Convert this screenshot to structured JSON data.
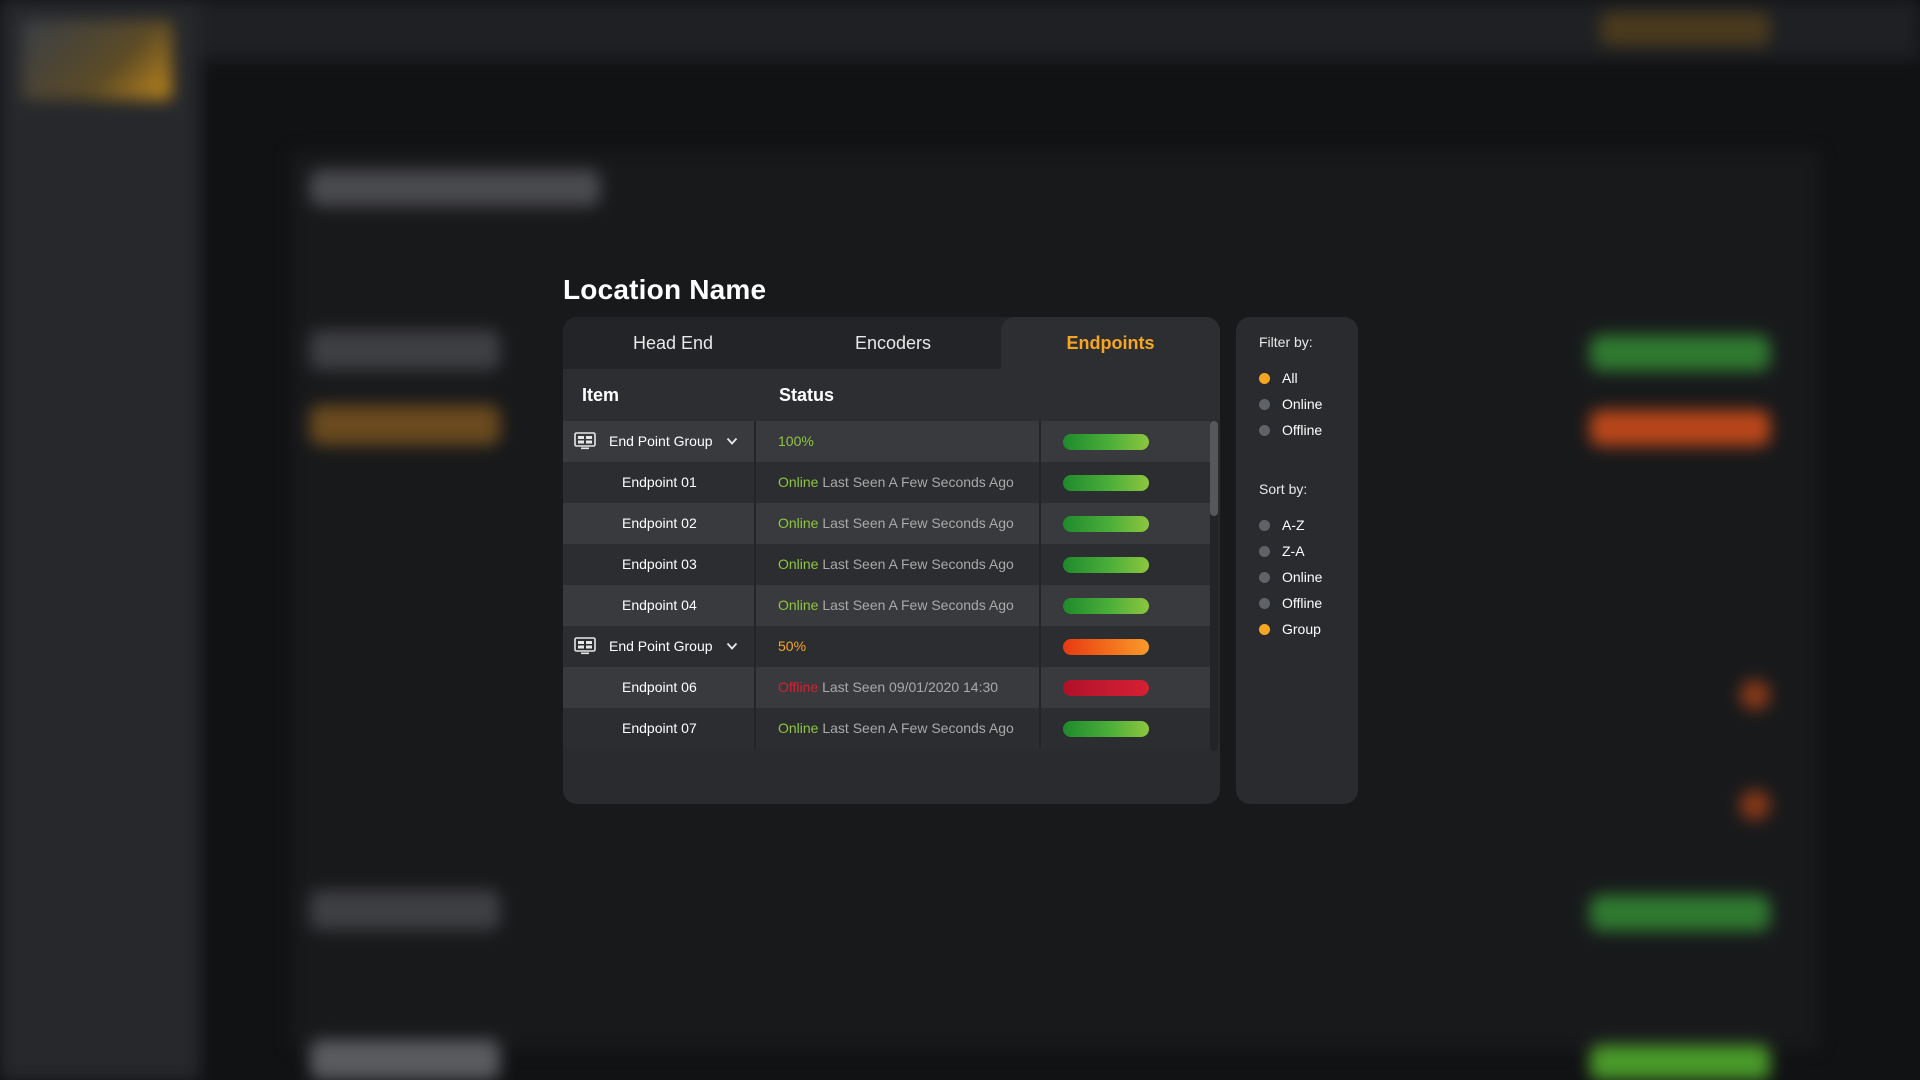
{
  "title": "Location Name",
  "tabs": [
    {
      "label": "Head End",
      "active": false
    },
    {
      "label": "Encoders",
      "active": false
    },
    {
      "label": "Endpoints",
      "active": true
    }
  ],
  "table": {
    "headers": {
      "item": "Item",
      "status": "Status"
    },
    "rows": [
      {
        "type": "group",
        "name": "End Point Group",
        "percent": "100%",
        "bar": "green",
        "fill": 1.0
      },
      {
        "type": "endpoint",
        "name": "Endpoint 01",
        "state": "Online",
        "last_seen": "Last Seen A Few Seconds Ago",
        "bar": "green",
        "fill": 1.0
      },
      {
        "type": "endpoint",
        "name": "Endpoint 02",
        "state": "Online",
        "last_seen": "Last Seen A Few Seconds Ago",
        "bar": "green",
        "fill": 1.0
      },
      {
        "type": "endpoint",
        "name": "Endpoint 03",
        "state": "Online",
        "last_seen": "Last Seen A Few Seconds Ago",
        "bar": "green",
        "fill": 1.0
      },
      {
        "type": "endpoint",
        "name": "Endpoint 04",
        "state": "Online",
        "last_seen": "Last Seen A Few Seconds Ago",
        "bar": "green",
        "fill": 1.0
      },
      {
        "type": "group",
        "name": "End Point Group",
        "percent": "50%",
        "bar": "orange",
        "fill": 1.0
      },
      {
        "type": "endpoint",
        "name": "Endpoint 06",
        "state": "Offline",
        "last_seen": "Last Seen 09/01/2020 14:30",
        "bar": "red",
        "fill": 1.0
      },
      {
        "type": "endpoint",
        "name": "Endpoint 07",
        "state": "Online",
        "last_seen": "Last Seen A Few Seconds Ago",
        "bar": "green",
        "fill": 1.0
      }
    ]
  },
  "filter": {
    "label": "Filter by:",
    "options": [
      {
        "label": "All",
        "selected": true
      },
      {
        "label": "Online",
        "selected": false
      },
      {
        "label": "Offline",
        "selected": false
      }
    ]
  },
  "sort": {
    "label": "Sort by:",
    "options": [
      {
        "label": "A-Z",
        "selected": false
      },
      {
        "label": "Z-A",
        "selected": false
      },
      {
        "label": "Online",
        "selected": false
      },
      {
        "label": "Offline",
        "selected": false
      },
      {
        "label": "Group",
        "selected": true
      }
    ]
  },
  "colors": {
    "accent": "#f5a623",
    "online": "#8dc63f",
    "offline": "#d42032",
    "panel": "#2a2b2e"
  },
  "icons": {
    "group": "monitor-group-icon",
    "expand": "chevron-down-icon"
  }
}
